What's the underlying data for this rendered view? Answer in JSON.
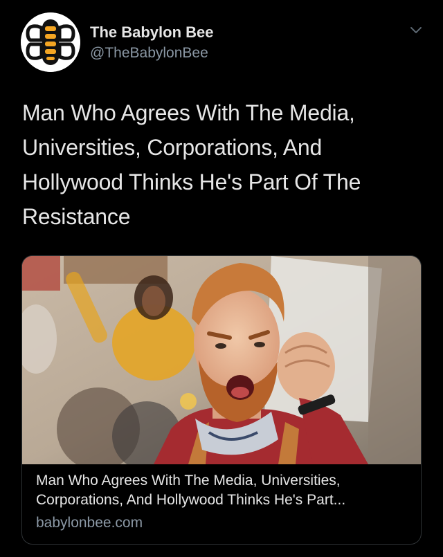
{
  "account": {
    "display_name": "The Babylon Bee",
    "handle": "@TheBabylonBee",
    "avatar_icon": "babylon-bee-logo-icon"
  },
  "menu": {
    "icon": "chevron-down-icon"
  },
  "tweet": {
    "text": "Man Who Agrees With The Media, Universities, Corporations, And Hollywood Thinks He's Part Of The Resistance"
  },
  "link_card": {
    "image_description_icon": "article-image",
    "title": "Man Who Agrees With The Media, Universities, Corporations, And Hollywood Thinks He's Part...",
    "domain": "babylonbee.com"
  },
  "colors": {
    "background": "#000000",
    "primary_text": "#e6e6e6",
    "secondary_text": "#8b98a5",
    "logo_orange": "#f5a623",
    "card_border": "#2f3336"
  }
}
